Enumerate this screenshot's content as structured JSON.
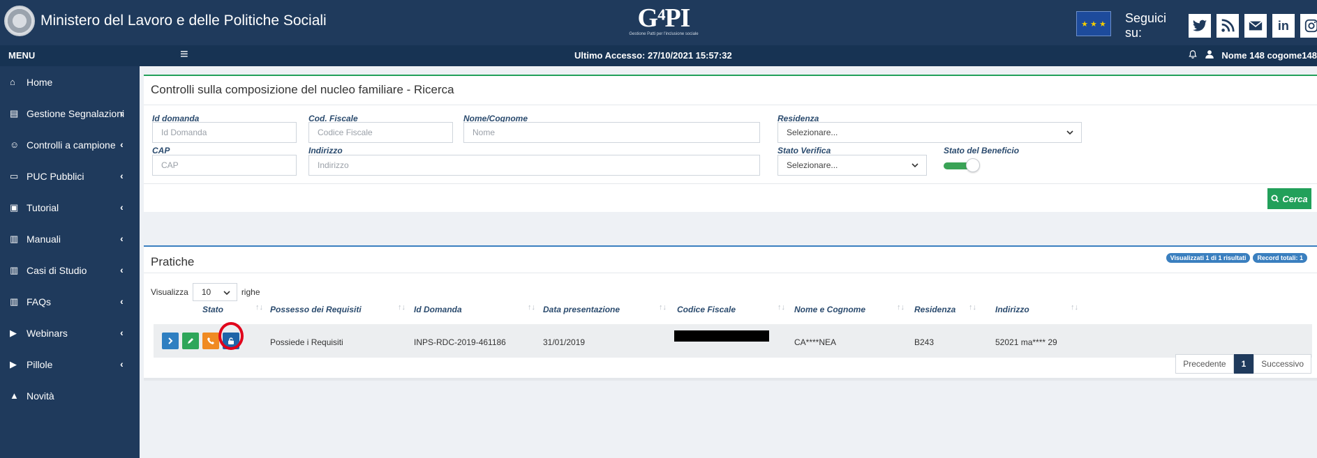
{
  "header": {
    "ministry": "Ministero del Lavoro e delle Politiche Sociali",
    "logo": "G⁴PI",
    "logo_sub": "Gestione Patti per l'inclusione sociale",
    "social_label": "Seguici su:",
    "social": [
      "twitter-icon",
      "rss-icon",
      "mail-icon",
      "linkedin-icon",
      "instagram-icon"
    ],
    "linkedin_text": "in"
  },
  "navbar": {
    "menu": "MENU",
    "last_access": "Ultimo Accesso: 27/10/2021 15:57:32",
    "user": "Nome 148 cogome148"
  },
  "sidebar": {
    "items": [
      {
        "label": "Home",
        "icon": "home-icon",
        "has_sub": false
      },
      {
        "label": "Gestione Segnalazioni",
        "icon": "truck-icon",
        "has_sub": true
      },
      {
        "label": "Controlli a campione",
        "icon": "people-icon",
        "has_sub": true
      },
      {
        "label": "PUC Pubblici",
        "icon": "monitor-icon",
        "has_sub": true
      },
      {
        "label": "Tutorial",
        "icon": "tutorial-icon",
        "has_sub": true
      },
      {
        "label": "Manuali",
        "icon": "book-icon",
        "has_sub": true
      },
      {
        "label": "Casi di Studio",
        "icon": "book-icon",
        "has_sub": true
      },
      {
        "label": "FAQs",
        "icon": "book-icon",
        "has_sub": true
      },
      {
        "label": "Webinars",
        "icon": "video-icon",
        "has_sub": true
      },
      {
        "label": "Pillole",
        "icon": "video-icon",
        "has_sub": true
      },
      {
        "label": "Novità",
        "icon": "bell-icon",
        "has_sub": false
      }
    ]
  },
  "search": {
    "title": "Controlli sulla composizione del nucleo familiare - Ricerca",
    "id_domanda_label": "Id domanda",
    "id_domanda_placeholder": "Id Domanda",
    "cf_label": "Cod. Fiscale",
    "cf_placeholder": "Codice Fiscale",
    "nome_label": "Nome/Cognome",
    "nome_placeholder": "Nome",
    "residenza_label": "Residenza",
    "residenza_value": "Selezionare...",
    "cap_label": "CAP",
    "cap_placeholder": "CAP",
    "indirizzo_label": "Indirizzo",
    "indirizzo_placeholder": "Indirizzo",
    "stato_verifica_label": "Stato Verifica",
    "stato_verifica_value": "Selezionare...",
    "stato_beneficio_label": "Stato del Beneficio",
    "cerca": "Cerca"
  },
  "results": {
    "title": "Pratiche",
    "badge_shown": "Visualizzati 1 di 1 risultati",
    "badge_total": "Record totali: 1",
    "show_prefix": "Visualizza",
    "page_size": "10",
    "show_suffix": "righe",
    "columns": [
      "Stato",
      "Possesso dei Requisiti",
      "Id Domanda",
      "Data presentazione",
      "Codice Fiscale",
      "Nome e Cognome",
      "Residenza",
      "Indirizzo"
    ],
    "row": {
      "requisiti": "Possiede i Requisiti",
      "id_domanda": "INPS-RDC-2019-461186",
      "data": "31/01/2019",
      "codice_fiscale": "",
      "nome": "CA****NEA",
      "residenza": "B243",
      "indirizzo": "52021 ma**** 29"
    },
    "actions": [
      {
        "name": "open-button",
        "color": "#2f7fc1"
      },
      {
        "name": "edit-button",
        "color": "#2ea65a"
      },
      {
        "name": "phone-button",
        "color": "#f08a22"
      },
      {
        "name": "unlock-button",
        "color": "#1f64a8"
      }
    ],
    "pager": {
      "prev": "Precedente",
      "page": "1",
      "next": "Successivo"
    }
  }
}
